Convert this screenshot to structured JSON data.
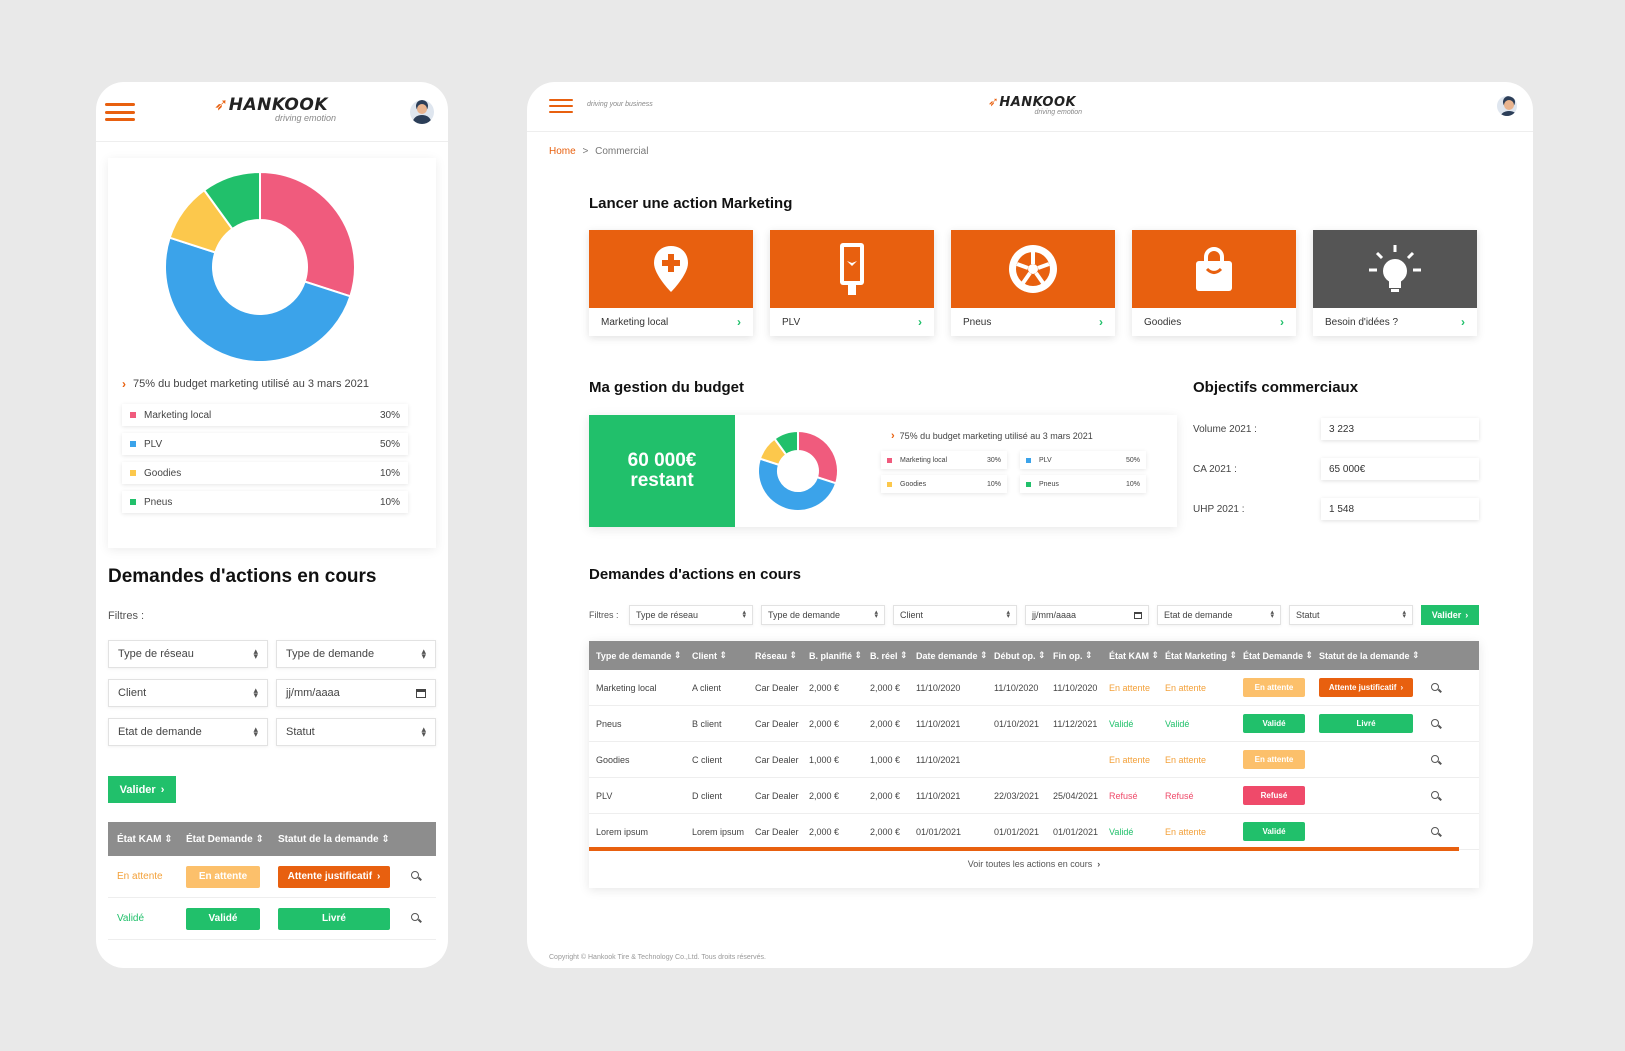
{
  "brand": {
    "name": "HANKOOK",
    "tagline": "driving emotion",
    "header_slogan": "driving your business"
  },
  "colors": {
    "orange": "#e8600f",
    "green": "#21c06b",
    "pink": "#f05b7d",
    "blue": "#3ba3ea",
    "yellow": "#fcc84c",
    "grey": "#555555"
  },
  "mobile": {
    "budget_note": "75% du budget marketing utilisé au 3 mars 2021",
    "legend": [
      {
        "label": "Marketing local",
        "pct": "30%",
        "color": "#f05b7d"
      },
      {
        "label": "PLV",
        "pct": "50%",
        "color": "#3ba3ea"
      },
      {
        "label": "Goodies",
        "pct": "10%",
        "color": "#fcc84c"
      },
      {
        "label": "Pneus",
        "pct": "10%",
        "color": "#21c06b"
      }
    ],
    "section_title": "Demandes d'actions en cours",
    "filters_label": "Filtres :",
    "filters": [
      "Type de réseau",
      "Type de demande",
      "Client",
      "jj/mm/aaaa",
      "Etat de demande",
      "Statut"
    ],
    "validate": "Valider",
    "table": {
      "headers": [
        "État KAM",
        "État Demande",
        "Statut de la demande"
      ],
      "rows": [
        {
          "kam": "En attente",
          "demande": "En attente",
          "statut": "Attente justificatif"
        },
        {
          "kam": "Validé",
          "demande": "Validé",
          "statut": "Livré"
        }
      ]
    }
  },
  "desktop": {
    "breadcrumb": {
      "home": "Home",
      "sep": ">",
      "current": "Commercial"
    },
    "marketing_title": "Lancer une action Marketing",
    "tiles": [
      {
        "label": "Marketing local",
        "icon": "map-pin-plus-icon"
      },
      {
        "label": "PLV",
        "icon": "display-stand-icon"
      },
      {
        "label": "Pneus",
        "icon": "tire-wheel-icon"
      },
      {
        "label": "Goodies",
        "icon": "shopping-bag-icon"
      },
      {
        "label": "Besoin d'idées ?",
        "icon": "lightbulb-icon"
      }
    ],
    "budget_title": "Ma gestion du budget",
    "budget_amount": "60 000€",
    "budget_remaining": "restant",
    "budget_note": "75% du budget marketing utilisé au 3 mars 2021",
    "objectives_title": "Objectifs commerciaux",
    "objectives": [
      {
        "label": "Volume 2021 :",
        "value": "3 223"
      },
      {
        "label": "CA 2021 :",
        "value": "65 000€"
      },
      {
        "label": "UHP 2021 :",
        "value": "1 548"
      }
    ],
    "requests_title": "Demandes d'actions en cours",
    "filters_label": "Filtres :",
    "filters": [
      "Type de réseau",
      "Type de demande",
      "Client",
      "jj/mm/aaaa",
      "Etat de demande",
      "Statut"
    ],
    "validate": "Valider",
    "table": {
      "headers": [
        "Type de demande",
        "Client",
        "Réseau",
        "B. planifié",
        "B. réel",
        "Date demande",
        "Début op.",
        "Fin op.",
        "État KAM",
        "État Marketing",
        "État Demande",
        "Statut de la demande"
      ],
      "rows": [
        {
          "type": "Marketing local",
          "client": "A client",
          "reseau": "Car Dealer",
          "bplan": "2,000 €",
          "breel": "2,000 €",
          "date": "11/10/2020",
          "debut": "11/10/2020",
          "fin": "11/10/2020",
          "kam": "En attente",
          "marketing": "En attente",
          "etat": "En attente",
          "statut": "Attente justificatif"
        },
        {
          "type": "Pneus",
          "client": "B client",
          "reseau": "Car Dealer",
          "bplan": "2,000 €",
          "breel": "2,000 €",
          "date": "11/10/2021",
          "debut": "01/10/2021",
          "fin": "11/12/2021",
          "kam": "Validé",
          "marketing": "Validé",
          "etat": "Validé",
          "statut": "Livré"
        },
        {
          "type": "Goodies",
          "client": "C client",
          "reseau": "Car Dealer",
          "bplan": "1,000 €",
          "breel": "1,000 €",
          "date": "11/10/2021",
          "debut": "",
          "fin": "",
          "kam": "En attente",
          "marketing": "En attente",
          "etat": "En attente",
          "statut": ""
        },
        {
          "type": "PLV",
          "client": "D client",
          "reseau": "Car Dealer",
          "bplan": "2,000 €",
          "breel": "2,000 €",
          "date": "11/10/2021",
          "debut": "22/03/2021",
          "fin": "25/04/2021",
          "kam": "Refusé",
          "marketing": "Refusé",
          "etat": "Refusé",
          "statut": ""
        },
        {
          "type": "Lorem ipsum",
          "client": "Lorem ipsum",
          "reseau": "Car Dealer",
          "bplan": "2,000 €",
          "breel": "2,000 €",
          "date": "01/01/2021",
          "debut": "01/01/2021",
          "fin": "01/01/2021",
          "kam": "Validé",
          "marketing": "En attente",
          "etat": "Validé",
          "statut": ""
        }
      ]
    },
    "see_all": "Voir toutes les actions en cours",
    "footer": "Copyright © Hankook Tire & Technology Co.,Ltd. Tous droits réservés."
  },
  "chart_data": {
    "type": "pie",
    "categories": [
      "Marketing local",
      "PLV",
      "Goodies",
      "Pneus"
    ],
    "values": [
      30,
      50,
      10,
      10
    ],
    "colors": [
      "#f05b7d",
      "#3ba3ea",
      "#fcc84c",
      "#21c06b"
    ]
  }
}
